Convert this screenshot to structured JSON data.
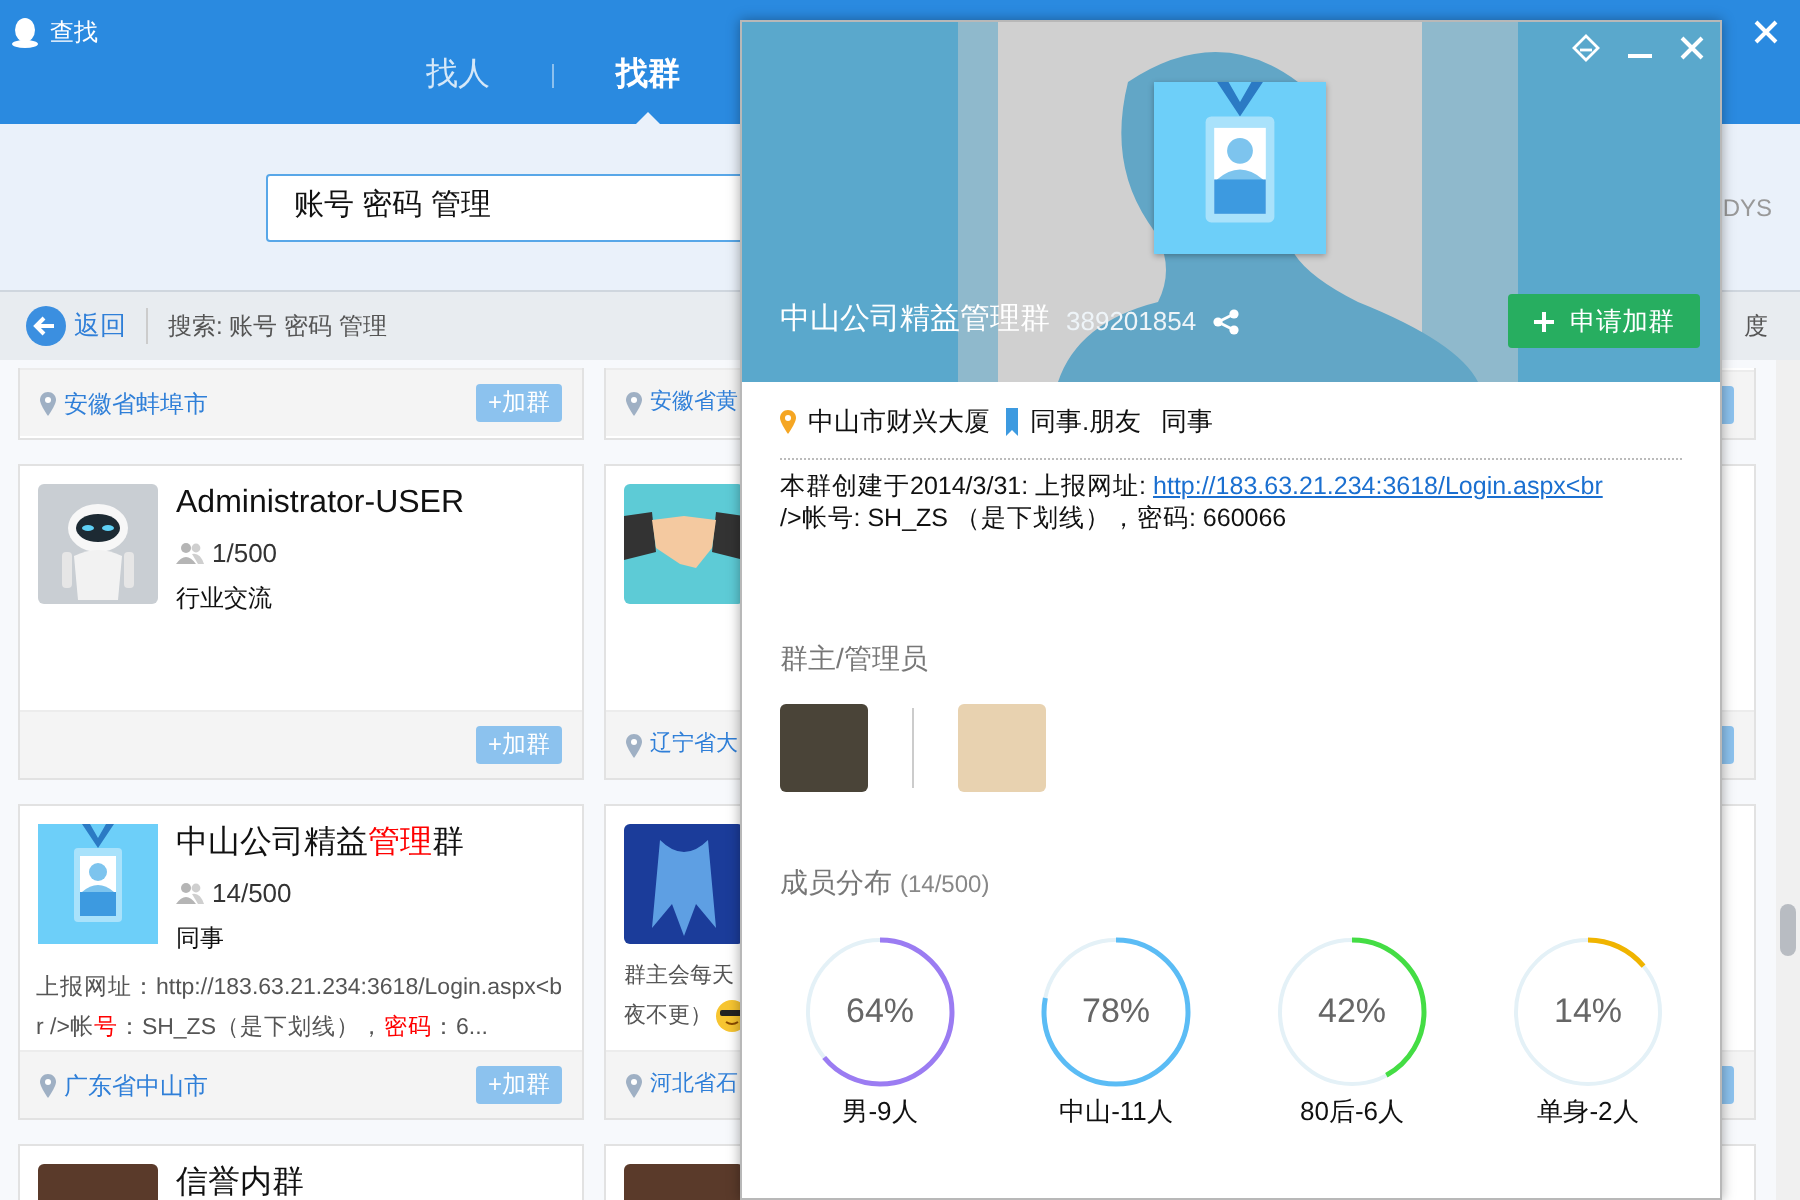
{
  "window": {
    "title": "查找",
    "tabs": [
      {
        "label": "找人",
        "selected": false
      },
      {
        "label": "找群",
        "selected": true
      }
    ]
  },
  "search": {
    "value": "账号 密码 管理",
    "side_text": "DYS"
  },
  "toolbar": {
    "back": "返回",
    "query": "搜索: 账号 密码 管理",
    "side_text": "度"
  },
  "results": [
    {
      "kind": "footer",
      "left": {
        "location": "安徽省蚌埠市",
        "join": "+加群"
      },
      "middle": {
        "location": "安徽省黄"
      }
    },
    {
      "kind": "full",
      "left": {
        "name_parts": [
          {
            "text": "Administrator-USER",
            "highlight": false
          }
        ],
        "members": "1/500",
        "tag": "行业交流",
        "join": "+加群"
      },
      "middle": {
        "location": "辽宁省大"
      }
    },
    {
      "kind": "full",
      "left": {
        "name_parts": [
          {
            "text": "中山公司精益",
            "highlight": false
          },
          {
            "text": "管理",
            "highlight": true
          },
          {
            "text": "群",
            "highlight": false
          }
        ],
        "members": "14/500",
        "tag": "同事",
        "desc_parts": [
          {
            "text": "上报网址：http://183.63.21.234:3618/Login.aspx<br />帐",
            "highlight": false
          },
          {
            "text": "号",
            "highlight": true
          },
          {
            "text": "：SH_ZS（是下划线），",
            "highlight": false
          },
          {
            "text": "密码",
            "highlight": true
          },
          {
            "text": "：6...",
            "highlight": false
          }
        ],
        "location": "广东省中山市",
        "join": "+加群"
      },
      "middle": {
        "desc_lines": [
          "群主会每天",
          "夜不更）"
        ],
        "location": "河北省石"
      }
    },
    {
      "kind": "top",
      "left": {
        "name_parts": [
          {
            "text": "信誉内群",
            "highlight": false
          }
        ]
      }
    }
  ],
  "group_card": {
    "name": "中山公司精益管理群",
    "number": "389201854",
    "apply": "申请加群",
    "location": "中山市财兴大厦",
    "category": "同事.朋友",
    "tag": "同事",
    "description": {
      "before": "本群创建于2014/3/31: 上报网址: ",
      "link": "http://183.63.21.234:3618/Login.aspx<br",
      "after": "/>帐号: SH_ZS （是下划线），密码: 660066"
    },
    "admins_title": "群主/管理员",
    "members_title": "成员分布",
    "members_count": "(14/500)",
    "distribution": [
      {
        "percent": "64%",
        "label": "男-9人",
        "level": 0.64,
        "color": "#9b7cf2"
      },
      {
        "percent": "78%",
        "label": "中山-11人",
        "level": 0.78,
        "color": "#5bbcf5"
      },
      {
        "percent": "42%",
        "label": "80后-6人",
        "level": 0.42,
        "color": "#44dd44"
      },
      {
        "percent": "14%",
        "label": "单身-2人",
        "level": 0.14,
        "color": "#f0b400"
      }
    ]
  }
}
